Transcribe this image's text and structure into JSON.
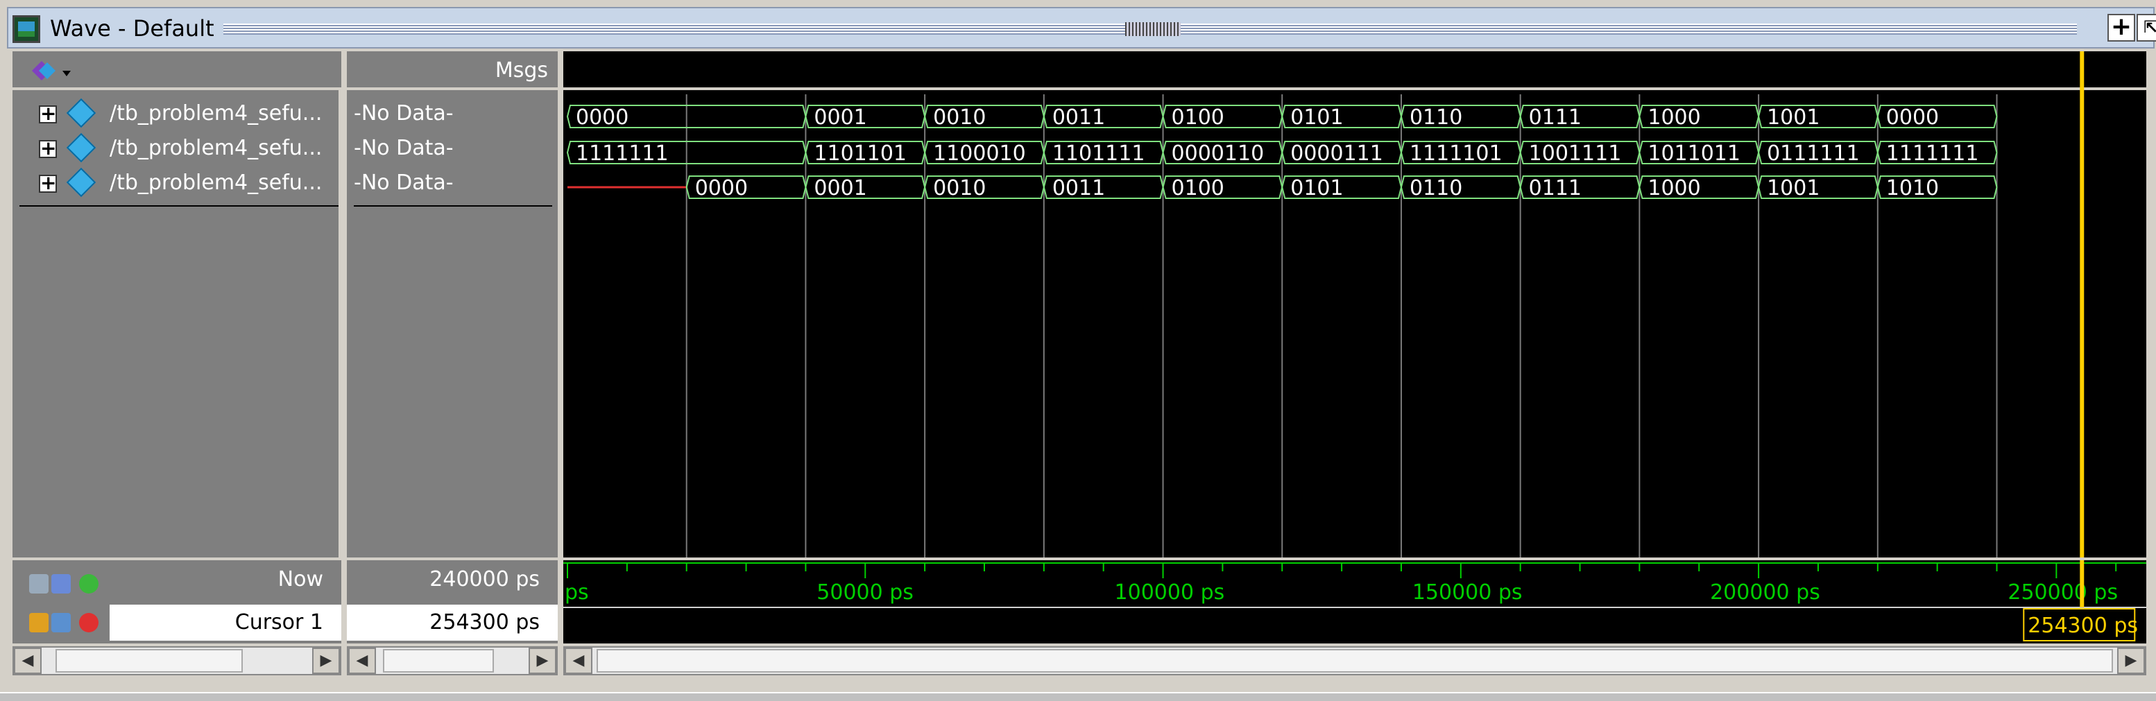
{
  "window": {
    "title": "Wave - Default"
  },
  "header": {
    "msgs_label": "Msgs"
  },
  "signals": [
    {
      "name": "/tb_problem4_sefu...",
      "value": "-No Data-"
    },
    {
      "name": "/tb_problem4_sefu...",
      "value": "-No Data-"
    },
    {
      "name": "/tb_problem4_sefu...",
      "value": "-No Data-"
    }
  ],
  "footer": {
    "now_label": "Now",
    "now_value": "240000 ps",
    "cursor_label": "Cursor 1",
    "cursor_value": "254300 ps",
    "cursor_flag": "254300 ps"
  },
  "waves": {
    "time_range_ps": [
      0,
      264400
    ],
    "rows": [
      {
        "segments": [
          {
            "t": 0,
            "v": "0000"
          },
          {
            "t": 40000,
            "v": "0001"
          },
          {
            "t": 60000,
            "v": "0010"
          },
          {
            "t": 80000,
            "v": "0011"
          },
          {
            "t": 100000,
            "v": "0100"
          },
          {
            "t": 120000,
            "v": "0101"
          },
          {
            "t": 140000,
            "v": "0110"
          },
          {
            "t": 160000,
            "v": "0111"
          },
          {
            "t": 180000,
            "v": "1000"
          },
          {
            "t": 200000,
            "v": "1001"
          },
          {
            "t": 220000,
            "v": "0000"
          }
        ],
        "end": 240000
      },
      {
        "segments": [
          {
            "t": 0,
            "v": "1111111"
          },
          {
            "t": 40000,
            "v": "1101101"
          },
          {
            "t": 60000,
            "v": "1100010"
          },
          {
            "t": 80000,
            "v": "1101111"
          },
          {
            "t": 100000,
            "v": "0000110"
          },
          {
            "t": 120000,
            "v": "0000111"
          },
          {
            "t": 140000,
            "v": "1111101"
          },
          {
            "t": 160000,
            "v": "1001111"
          },
          {
            "t": 180000,
            "v": "1011011"
          },
          {
            "t": 200000,
            "v": "0111111"
          },
          {
            "t": 220000,
            "v": "1111111"
          }
        ],
        "end": 240000
      },
      {
        "undefined_until": 20000,
        "segments": [
          {
            "t": 20000,
            "v": "0000"
          },
          {
            "t": 40000,
            "v": "0001"
          },
          {
            "t": 60000,
            "v": "0010"
          },
          {
            "t": 80000,
            "v": "0011"
          },
          {
            "t": 100000,
            "v": "0100"
          },
          {
            "t": 120000,
            "v": "0101"
          },
          {
            "t": 140000,
            "v": "0110"
          },
          {
            "t": 160000,
            "v": "0111"
          },
          {
            "t": 180000,
            "v": "1000"
          },
          {
            "t": 200000,
            "v": "1001"
          },
          {
            "t": 220000,
            "v": "1010"
          }
        ],
        "end": 240000
      }
    ],
    "time_axis": {
      "labels": [
        {
          "t": 0,
          "text": "ps"
        },
        {
          "t": 50000,
          "text": "50000 ps"
        },
        {
          "t": 100000,
          "text": "100000 ps"
        },
        {
          "t": 150000,
          "text": "150000 ps"
        },
        {
          "t": 200000,
          "text": "200000 ps"
        },
        {
          "t": 250000,
          "text": "250000 ps"
        }
      ]
    },
    "cursor_time": 254300,
    "colors": {
      "bus": "#7fe07f",
      "undef": "#e03030",
      "grid": "#7a7a7a",
      "axis": "#00d000",
      "cursor": "#ffd000"
    }
  }
}
